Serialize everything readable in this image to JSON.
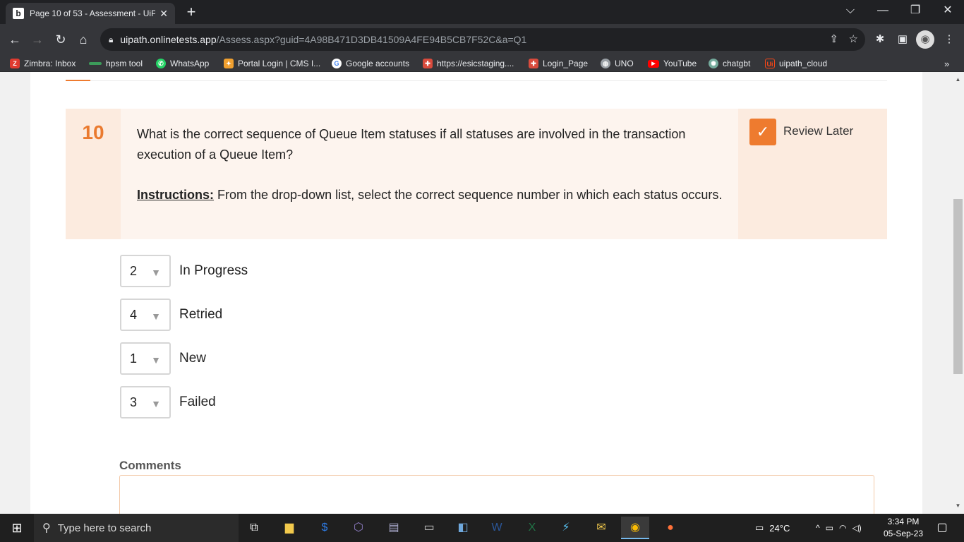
{
  "browser": {
    "tab_title": "Page 10 of 53 - Assessment - UiP",
    "tab_favicon": "b",
    "url_host": "uipath.onlinetests.app",
    "url_path": "/Assess.aspx?guid=4A98B471D3DB41509A4FE94B5CB7F52C&a=Q1"
  },
  "bookmarks": [
    {
      "label": "Zimbra: Inbox",
      "color": "#e03a2f"
    },
    {
      "label": "hpsm tool",
      "color": "#3c9b5a"
    },
    {
      "label": "WhatsApp",
      "color": "#25d366"
    },
    {
      "label": "Portal Login | CMS I...",
      "color": "#f0a030"
    },
    {
      "label": "Google accounts",
      "color": "#4285f4"
    },
    {
      "label": "https://esicstaging....",
      "color": "#d94b3d"
    },
    {
      "label": "Login_Page",
      "color": "#d94b3d"
    },
    {
      "label": "UNO",
      "color": "#9aa0a6"
    },
    {
      "label": "YouTube",
      "color": "#ff0000"
    },
    {
      "label": "chatgbt",
      "color": "#74aa9c"
    },
    {
      "label": "uipath_cloud",
      "color": "#fa4616"
    }
  ],
  "question": {
    "number": "10",
    "text": "What is the correct sequence of Queue Item statuses if all statuses are involved in the transaction execution of a Queue Item?",
    "instructions_label": "Instructions:",
    "instructions_text": " From the drop-down list, select the correct sequence number in which each status occurs.",
    "review_label": "Review Later",
    "review_checked": true
  },
  "answers": [
    {
      "value": "2",
      "label": "In Progress"
    },
    {
      "value": "4",
      "label": "Retried"
    },
    {
      "value": "1",
      "label": "New"
    },
    {
      "value": "3",
      "label": "Failed"
    }
  ],
  "comments": {
    "label": "Comments",
    "value": ""
  },
  "taskbar": {
    "search_placeholder": "Type here to search",
    "weather": "24°C",
    "time": "3:34 PM",
    "date": "05-Sep-23"
  },
  "colors": {
    "accent": "#ee7b2f",
    "question_bg": "#fdf4ee"
  }
}
